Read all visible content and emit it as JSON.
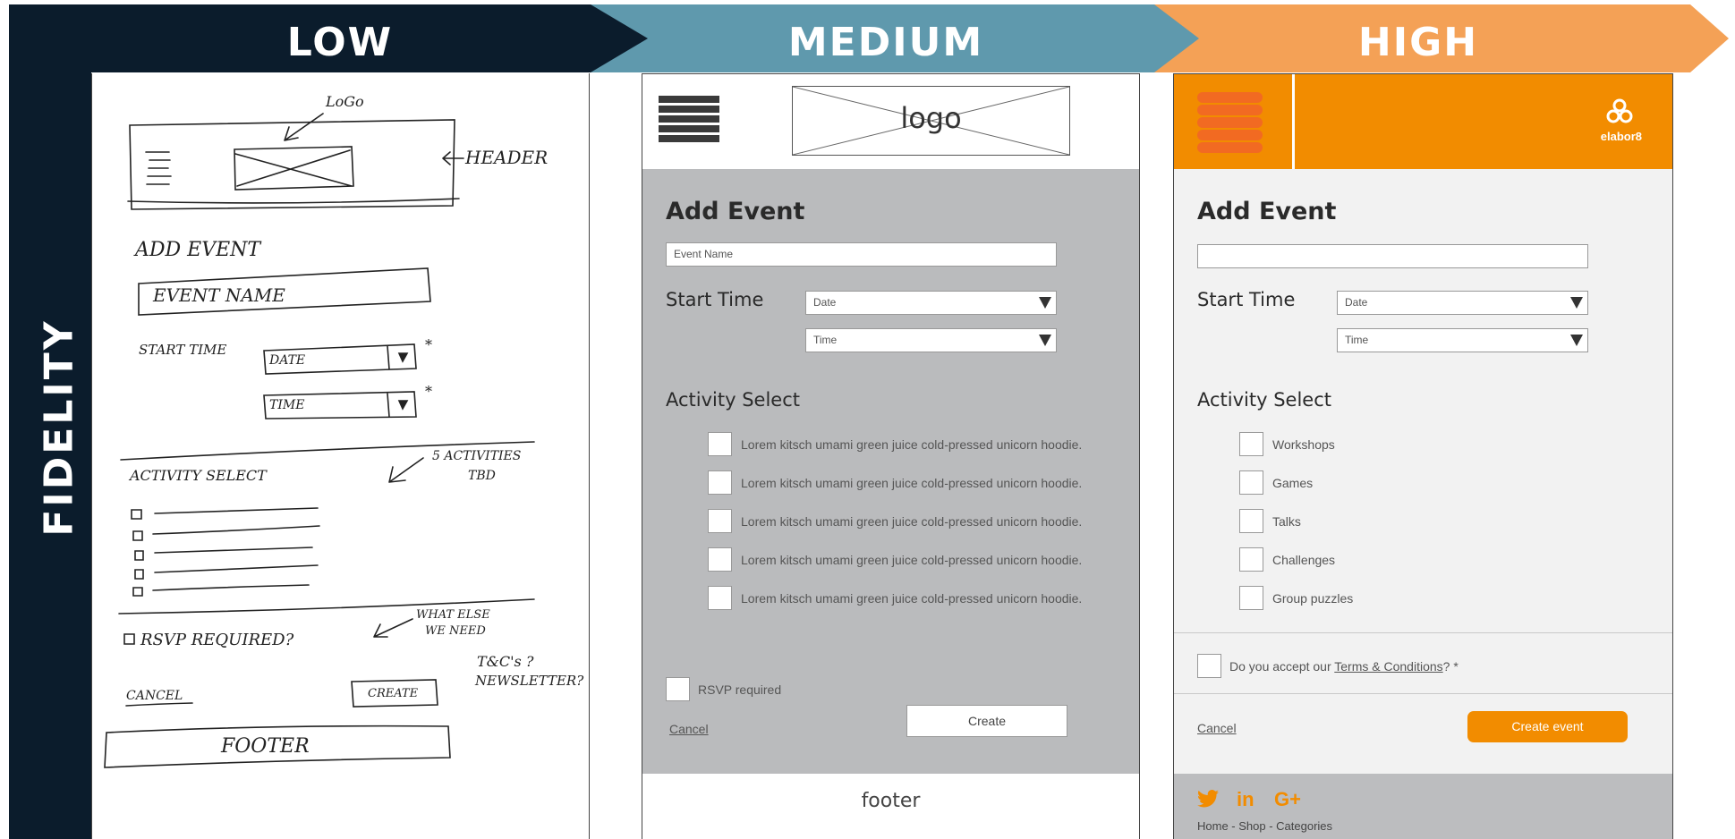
{
  "banner": {
    "low": "LOW",
    "medium": "MEDIUM",
    "high": "HIGH",
    "axis": "FIDELITY",
    "colors": {
      "low": "#0b1c2c",
      "medium": "#5f99ad",
      "high": "#f4a156"
    }
  },
  "low": {
    "logo_note": "LoGo",
    "header_note": "HEADER",
    "title": "ADD EVENT",
    "event_name": "EVENT NAME",
    "start_time": "START TIME",
    "date": "DATE",
    "time": "TIME",
    "activity_select": "ACTIVITY SELECT",
    "activities_note_line1": "5 ACTIVITIES",
    "activities_note_line2": "TBD",
    "rsvp": "RSVP REQUIRED?",
    "what_else_line1": "WHAT ELSE",
    "what_else_line2": "WE NEED",
    "tcs": "T&C's ?",
    "newsletter": "NEWSLETTER?",
    "cancel": "CANCEL",
    "create": "CREATE",
    "footer": "FOOTER",
    "asterisk": "*"
  },
  "medium": {
    "logo": "logo",
    "title": "Add Event",
    "event_name_placeholder": "Event Name",
    "start_time": "Start Time",
    "date_placeholder": "Date",
    "time_placeholder": "Time",
    "activity_select": "Activity Select",
    "activities": [
      "Lorem kitsch umami green juice cold-pressed unicorn hoodie.",
      "Lorem kitsch umami green juice cold-pressed unicorn hoodie.",
      "Lorem kitsch umami green juice cold-pressed unicorn hoodie.",
      "Lorem kitsch umami green juice cold-pressed unicorn hoodie.",
      "Lorem kitsch umami green juice cold-pressed unicorn hoodie."
    ],
    "rsvp": "RSVP required",
    "cancel": "Cancel",
    "create": "Create",
    "footer": "footer"
  },
  "high": {
    "brand": "elabor8",
    "title": "Add Event",
    "event_name_value": "",
    "start_time": "Start Time",
    "date_placeholder": "Date",
    "time_placeholder": "Time",
    "activity_select": "Activity Select",
    "activities": [
      "Workshops",
      "Games",
      "Talks",
      "Challenges",
      "Group puzzles"
    ],
    "terms_prefix": "Do you accept our ",
    "terms_link": "Terms & Conditions",
    "terms_suffix": "? *",
    "cancel": "Cancel",
    "create": "Create event",
    "social": {
      "twitter": "twitter-icon",
      "linkedin": "in",
      "googleplus": "G+"
    },
    "footer_links": "Home - Shop - Categories",
    "accent": "#f28c00"
  }
}
